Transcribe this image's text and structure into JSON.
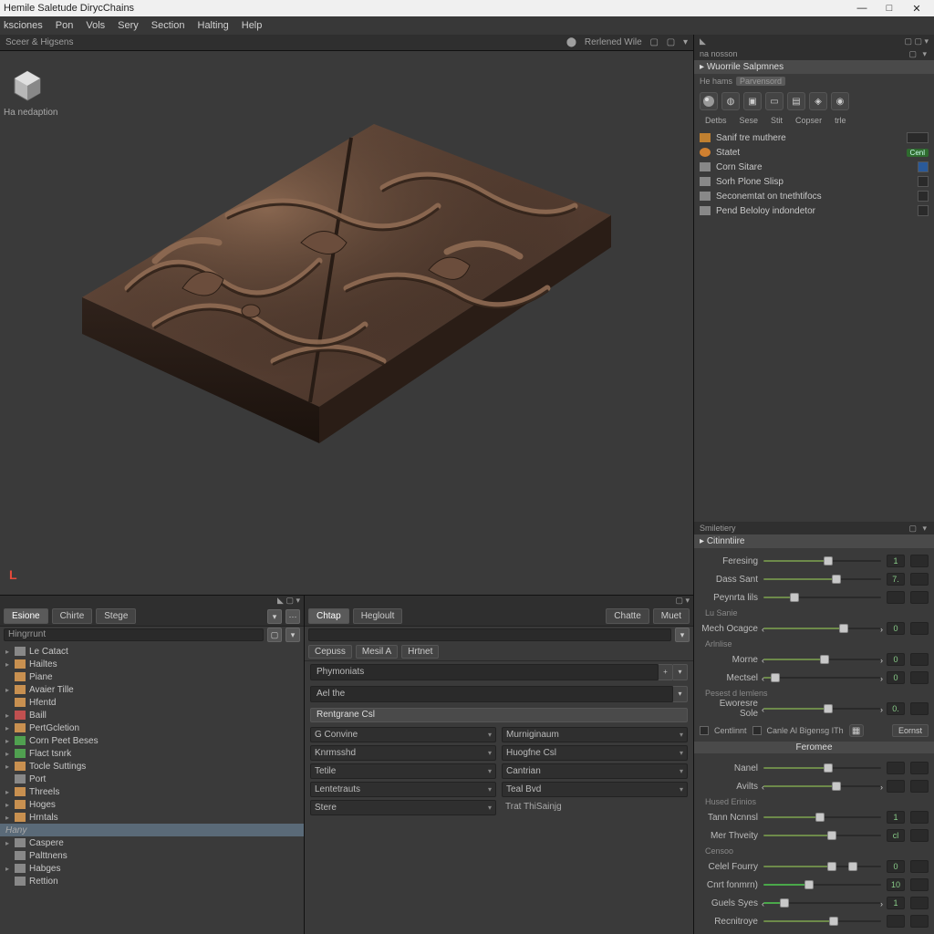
{
  "window": {
    "title": "Hemile Saletude DirycChains"
  },
  "menu": [
    "ksciones",
    "Pon",
    "Vols",
    "Sery",
    "Section",
    "Halting",
    "Help"
  ],
  "viewport": {
    "header_left": "Sceer & Higsens",
    "header_right": "Rerlened Wile",
    "corner_label": "Ha nedaption",
    "axis": "L"
  },
  "outliner": {
    "tabs": [
      "Esione",
      "Chirte",
      "Stege"
    ],
    "header_sub": "Hingrrunt",
    "items": [
      {
        "label": "Le Catact",
        "icon": "folder",
        "twisty": "▸"
      },
      {
        "label": "Hailtes",
        "icon": "mesh",
        "twisty": "▸"
      },
      {
        "label": "Piane",
        "icon": "mesh",
        "twisty": ""
      },
      {
        "label": "Avaier Tille",
        "icon": "mesh",
        "twisty": "▸"
      },
      {
        "label": "Hfentd",
        "icon": "mesh",
        "twisty": ""
      },
      {
        "label": "Baill",
        "icon": "red",
        "twisty": "▸"
      },
      {
        "label": "PertGcletion",
        "icon": "mesh",
        "twisty": "▸"
      },
      {
        "label": "Corn Peet Beses",
        "icon": "green",
        "twisty": "▸"
      },
      {
        "label": "Flact tsnrk",
        "icon": "green",
        "twisty": "▸"
      },
      {
        "label": "Tocle Suttings",
        "icon": "mesh",
        "twisty": "▸"
      },
      {
        "label": "Port",
        "icon": "folder",
        "twisty": ""
      },
      {
        "label": "Threels",
        "icon": "mesh",
        "twisty": "▸"
      },
      {
        "label": "Hoges",
        "icon": "mesh",
        "twisty": "▸"
      },
      {
        "label": "Hrntals",
        "icon": "mesh",
        "twisty": "▸"
      }
    ],
    "group": "Hany",
    "items2": [
      {
        "label": "Caspere",
        "icon": "folder",
        "twisty": "▸"
      },
      {
        "label": "Palttnens",
        "icon": "folder",
        "twisty": ""
      },
      {
        "label": "Habges",
        "icon": "folder",
        "twisty": "▸"
      },
      {
        "label": "Rettion",
        "icon": "folder",
        "twisty": ""
      }
    ]
  },
  "props": {
    "tabs1": [
      "Chtap",
      "Hegloult",
      "Chatte",
      "Muet"
    ],
    "tabs2": [
      "Cepuss",
      "Mesil A",
      "Hrtnet"
    ],
    "combo1": "Phymoniats",
    "addline": "Ael the",
    "header1": "Rentgrane Csl",
    "grid": [
      [
        "G Convine",
        "Murniginaum"
      ],
      [
        "Knrmsshd",
        "Huogfne Csl"
      ],
      [
        "Tetile",
        "Cantrian"
      ],
      [
        "Lentetrauts",
        "Teal Bvd"
      ],
      [
        "Stere",
        "Trat ThiSainjg"
      ]
    ]
  },
  "inspector": {
    "panel_small": "na nosson",
    "title": "Wuorrile Salpmnes",
    "sub_label": "He hams",
    "sub_tag": "Parvensord",
    "col_tabs": [
      "Detbs",
      "Sese",
      "Stit",
      "Copser",
      "trle"
    ],
    "list": [
      {
        "label": "Sanif tre muthere",
        "icon": "bfolder",
        "right": "bar"
      },
      {
        "label": "Statet",
        "icon": "bdot",
        "right": "pill",
        "pill": "Cenl"
      },
      {
        "label": "Corn Sitare",
        "icon": "bbox",
        "right": "blue"
      },
      {
        "label": "Sorh Plone Slisp",
        "icon": "bbox",
        "right": "square"
      },
      {
        "label": "Seconemtat on tnethtifocs",
        "icon": "bbox",
        "right": "square"
      },
      {
        "label": "Pend Beloloy indondetor",
        "icon": "bbox",
        "right": "square"
      }
    ]
  },
  "sliders1": {
    "panel_small": "Smiletiery",
    "title": "Citinntiire",
    "rows": [
      {
        "label": "Feresing",
        "pos": 55,
        "val": "1"
      },
      {
        "label": "Dass Sant",
        "pos": 62,
        "val": "7."
      },
      {
        "label": "Peynrta lils",
        "pos": 26,
        "val": ""
      },
      {
        "sub": "Lu Sanie"
      },
      {
        "label": "Mech Ocagce",
        "pos": 68,
        "val": "0",
        "arrows": true
      },
      {
        "sub": "Arlnlise"
      },
      {
        "label": "Morne",
        "pos": 52,
        "val": "0",
        "arrows": true
      },
      {
        "label": "Mectsel",
        "pos": 10,
        "val": "0",
        "arrows": true
      },
      {
        "sub": "Pesest d lemlens"
      },
      {
        "label": "Eworesre Sole",
        "pos": 55,
        "val": "0.",
        "arrows": true
      }
    ],
    "checks": {
      "c1": "Centlinnt",
      "c2": "Canle Al Bigensg ITh",
      "btn": "Eornst"
    },
    "divider": "Feromee"
  },
  "sliders2": {
    "rows": [
      {
        "label": "Nanel",
        "pos": 55,
        "val": ""
      },
      {
        "label": "Avilts",
        "pos": 62,
        "val": "",
        "arrows": true
      },
      {
        "sub": "Hused Erinios"
      },
      {
        "label": "Tann Ncnnsl",
        "pos": 48,
        "val": "1"
      },
      {
        "label": "Mer Thveity",
        "pos": 58,
        "val": "cl"
      },
      {
        "sub": "Censoo"
      },
      {
        "label": "Celel Fourry",
        "pos": 58,
        "val": "0",
        "double": true
      },
      {
        "label": "Cnrt fonmrn)",
        "pos": 39,
        "val": "10",
        "green": true
      },
      {
        "label": "Guels Syes",
        "pos": 18,
        "val": "1",
        "green": true,
        "arrows": true
      },
      {
        "label": "Recnitroye",
        "pos": 60,
        "val": ""
      }
    ]
  }
}
